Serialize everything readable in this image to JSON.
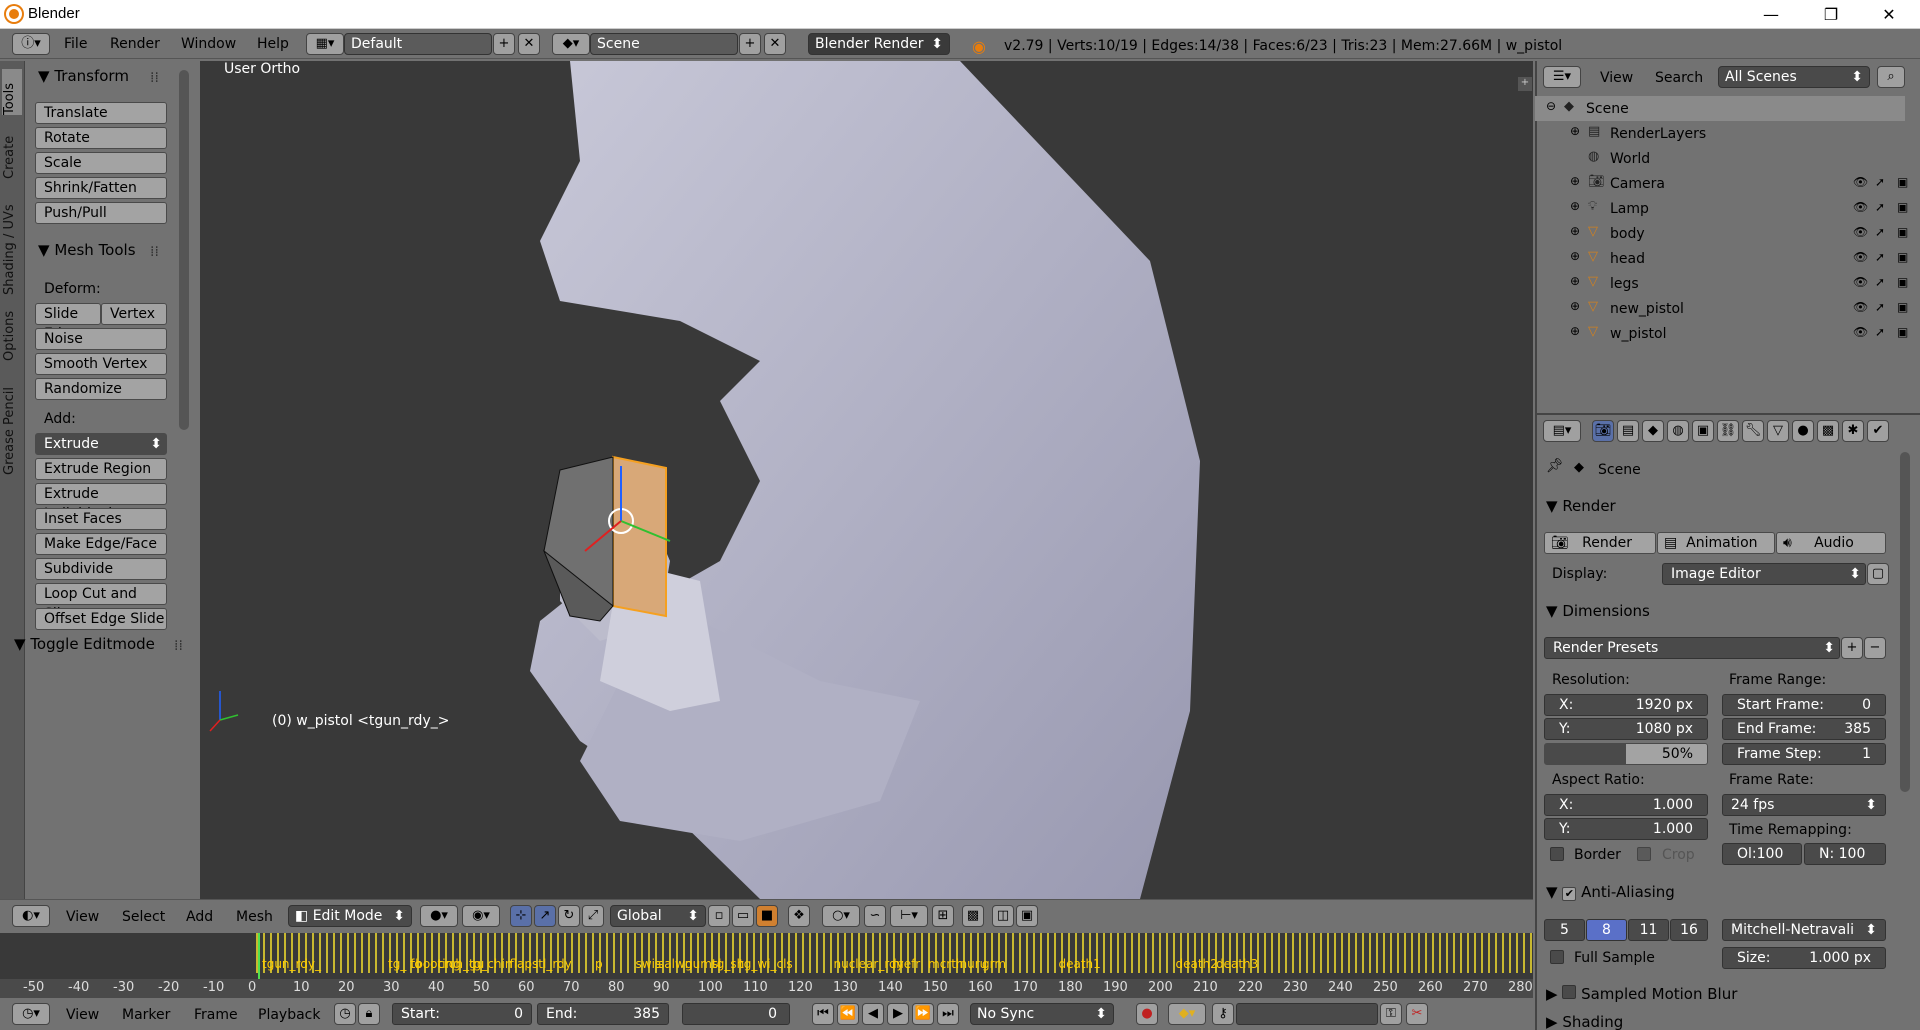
{
  "window": {
    "title": "Blender",
    "min": "—",
    "max": "❐",
    "close": "✕"
  },
  "info": {
    "menus": [
      "File",
      "Render",
      "Window",
      "Help"
    ],
    "screen_layout": "Default",
    "scene": "Scene",
    "engine": "Blender Render",
    "stats": "v2.79 | Verts:10/19 | Edges:14/38 | Faces:6/23 | Tris:23 | Mem:27.66M | w_pistol"
  },
  "tool_tabs": [
    "Tools",
    "Create",
    "Shading / UVs",
    "Options",
    "Grease Pencil"
  ],
  "tools": {
    "transform_header": "Transform",
    "transform": [
      "Translate",
      "Rotate",
      "Scale",
      "Shrink/Fatten",
      "Push/Pull"
    ],
    "mesh_tools_header": "Mesh Tools",
    "deform_label": "Deform:",
    "slide_edge": "Slide Ed",
    "vertex": "Vertex",
    "deform": [
      "Noise",
      "Smooth Vertex",
      "Randomize"
    ],
    "add_label": "Add:",
    "extrude": "Extrude",
    "add": [
      "Extrude Region",
      "Extrude Individual",
      "Inset Faces",
      "Make Edge/Face",
      "Subdivide",
      "Loop Cut and Sli...",
      "Offset Edge Slide"
    ],
    "toggle_editmode": "Toggle Editmode"
  },
  "viewport": {
    "view_name": "User Ortho",
    "object_info": "(0) w_pistol <tgun_rdy_>",
    "menus": [
      "View",
      "Select",
      "Add",
      "Mesh"
    ],
    "mode": "Edit Mode",
    "orientation": "Global"
  },
  "timeline": {
    "ruler": [
      "-50",
      "-40",
      "-30",
      "-20",
      "-10",
      "0",
      "10",
      "20",
      "30",
      "40",
      "50",
      "60",
      "70",
      "80",
      "90",
      "100",
      "110",
      "120",
      "130",
      "140",
      "150",
      "160",
      "170",
      "180",
      "190",
      "200",
      "210",
      "220",
      "230",
      "240",
      "250",
      "260",
      "270",
      "280"
    ],
    "markers": [
      "tgun_rdy_",
      "tg_ fo",
      "tbooting",
      "crch_gu",
      "tg_chin",
      "flapstl_rdy",
      "p",
      "swis",
      "salwn",
      "gumsl",
      "tg_sh",
      "tg_wi_cls",
      "nuclear_rdy",
      "mefr",
      "mcrth",
      "nuru",
      "grm",
      "death1",
      "death2",
      "death3"
    ],
    "menus": [
      "View",
      "Marker",
      "Frame",
      "Playback"
    ],
    "start_label": "Start:",
    "start": "0",
    "end_label": "End:",
    "end": "385",
    "current": "0",
    "sync": "No Sync"
  },
  "outliner": {
    "menus": [
      "View",
      "Search"
    ],
    "filter": "All Scenes",
    "items": [
      {
        "name": "Scene",
        "indent": 0
      },
      {
        "name": "RenderLayers",
        "indent": 1
      },
      {
        "name": "World",
        "indent": 1
      },
      {
        "name": "Camera",
        "indent": 1
      },
      {
        "name": "Lamp",
        "indent": 1
      },
      {
        "name": "body",
        "indent": 1
      },
      {
        "name": "head",
        "indent": 1
      },
      {
        "name": "legs",
        "indent": 1
      },
      {
        "name": "new_pistol",
        "indent": 1
      },
      {
        "name": "w_pistol",
        "indent": 1
      }
    ]
  },
  "properties": {
    "context": "Scene",
    "render_header": "Render",
    "render_btn": "Render",
    "animation_btn": "Animation",
    "audio_btn": "Audio",
    "display_label": "Display:",
    "display": "Image Editor",
    "dimensions_header": "Dimensions",
    "render_presets": "Render Presets",
    "resolution_label": "Resolution:",
    "res_x_label": "X:",
    "res_x": "1920 px",
    "res_y_label": "Y:",
    "res_y": "1080 px",
    "res_pct": "50%",
    "frame_range_label": "Frame Range:",
    "start_frame_label": "Start Frame:",
    "start_frame": "0",
    "end_frame_label": "End Frame:",
    "end_frame": "385",
    "frame_step_label": "Frame Step:",
    "frame_step": "1",
    "aspect_label": "Aspect Ratio:",
    "asp_x_label": "X:",
    "asp_x": "1.000",
    "asp_y_label": "Y:",
    "asp_y": "1.000",
    "frame_rate_label": "Frame Rate:",
    "frame_rate": "24 fps",
    "time_remap_label": "Time Remapping:",
    "old": "Ol:100",
    "new": "N: 100",
    "border": "Border",
    "crop": "Crop",
    "aa_header": "Anti-Aliasing",
    "aa_samples": [
      "5",
      "8",
      "11",
      "16"
    ],
    "aa_filter": "Mitchell-Netravali",
    "full_sample": "Full Sample",
    "size_label": "Size:",
    "size": "1.000 px",
    "motion_blur": "Sampled Motion Blur",
    "shading": "Shading"
  }
}
